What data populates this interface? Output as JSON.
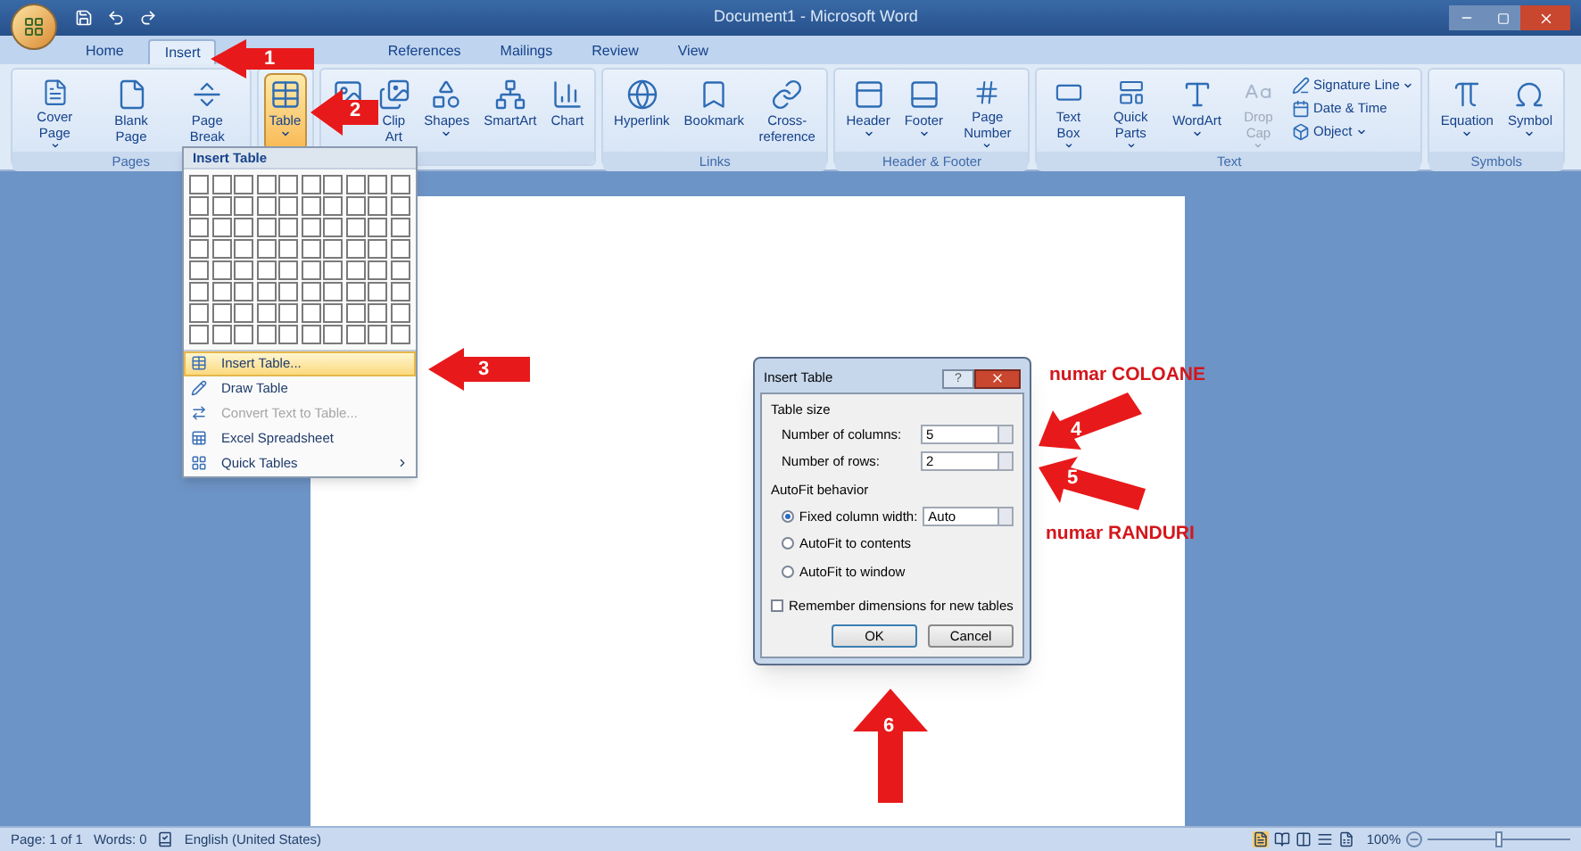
{
  "window": {
    "title": "Document1 - Microsoft Word"
  },
  "tabs": [
    {
      "label": "Home",
      "selected": false
    },
    {
      "label": "Insert",
      "selected": true
    },
    {
      "label": "References",
      "selected": false
    },
    {
      "label": "Mailings",
      "selected": false
    },
    {
      "label": "Review",
      "selected": false
    },
    {
      "label": "View",
      "selected": false
    }
  ],
  "ribbon_groups": [
    {
      "label": "Pages",
      "buttons": [
        {
          "kind": "large",
          "label": "Cover Page",
          "dropdown": true,
          "selected": false,
          "disabled": false
        },
        {
          "kind": "large",
          "label": "Blank Page",
          "dropdown": false,
          "selected": false,
          "disabled": false
        },
        {
          "kind": "large",
          "label": "Page Break",
          "dropdown": false,
          "selected": false,
          "disabled": false
        }
      ]
    },
    {
      "buttons": [
        {
          "kind": "large",
          "label": "Table",
          "dropdown": true,
          "selected": true,
          "disabled": false
        }
      ]
    },
    {
      "buttons": [
        {
          "kind": "large",
          "dropdown": false,
          "selected": false,
          "disabled": false
        },
        {
          "kind": "large",
          "label": "Clip Art",
          "dropdown": false,
          "selected": false,
          "disabled": false
        },
        {
          "kind": "large",
          "label": "Shapes",
          "dropdown": true,
          "selected": false,
          "disabled": false
        },
        {
          "kind": "large",
          "label": "SmartArt",
          "dropdown": false,
          "selected": false,
          "disabled": false
        },
        {
          "kind": "large",
          "label": "Chart",
          "dropdown": false,
          "selected": false,
          "disabled": false
        }
      ]
    },
    {
      "label": "Links",
      "buttons": [
        {
          "kind": "large",
          "label": "Hyperlink",
          "dropdown": false,
          "selected": false,
          "disabled": false
        },
        {
          "kind": "large",
          "label": "Bookmark",
          "dropdown": false,
          "selected": false,
          "disabled": false
        },
        {
          "kind": "large",
          "label": "Cross-reference",
          "dropdown": false,
          "selected": false,
          "disabled": false
        }
      ]
    },
    {
      "label": "Header & Footer",
      "buttons": [
        {
          "kind": "large",
          "label": "Header",
          "dropdown": true,
          "selected": false,
          "disabled": false
        },
        {
          "kind": "large",
          "label": "Footer",
          "dropdown": true,
          "selected": false,
          "disabled": false
        },
        {
          "kind": "large",
          "label": "Page Number",
          "dropdown": true,
          "selected": false,
          "disabled": false
        }
      ]
    },
    {
      "label": "Text",
      "buttons": [
        {
          "kind": "large",
          "label": "Text Box",
          "dropdown": true,
          "selected": false,
          "disabled": false
        },
        {
          "kind": "large",
          "label": "Quick Parts",
          "dropdown": true,
          "selected": false,
          "disabled": false
        },
        {
          "kind": "large",
          "label": "WordArt",
          "dropdown": true,
          "selected": false,
          "disabled": false
        },
        {
          "kind": "large",
          "label": "Drop Cap",
          "dropdown": true,
          "selected": false,
          "disabled": true
        },
        {
          "kind": "small",
          "label": "Signature Line",
          "dropdown": true,
          "selected": false,
          "disabled": false
        },
        {
          "kind": "small",
          "label": "Date & Time",
          "dropdown": false,
          "selected": false,
          "disabled": false
        },
        {
          "kind": "small",
          "label": "Object",
          "dropdown": true,
          "selected": false,
          "disabled": false
        }
      ]
    },
    {
      "label": "Symbols",
      "buttons": [
        {
          "kind": "large",
          "label": "Equation",
          "dropdown": true,
          "selected": false,
          "disabled": false
        },
        {
          "kind": "large",
          "label": "Symbol",
          "dropdown": true,
          "selected": false,
          "disabled": false
        }
      ]
    }
  ],
  "table_menu": {
    "title": "Insert Table",
    "items": [
      {
        "label": "Insert Table...",
        "selected": true,
        "disabled": false,
        "submenu": false
      },
      {
        "label": "Draw Table",
        "selected": false,
        "disabled": false,
        "submenu": false
      },
      {
        "label": "Convert Text to Table...",
        "selected": false,
        "disabled": true,
        "submenu": false
      },
      {
        "label": "Excel Spreadsheet",
        "selected": false,
        "disabled": false,
        "submenu": false
      },
      {
        "label": "Quick Tables",
        "selected": false,
        "disabled": false,
        "submenu": true
      }
    ]
  },
  "dialog": {
    "title": "Insert Table",
    "help": "?",
    "table_size": {
      "heading": "Table size",
      "fields": [
        {
          "label": "Number of columns:",
          "value": "5"
        },
        {
          "label": "Number of rows:",
          "value": "2"
        }
      ]
    },
    "autofit": {
      "heading": "AutoFit behavior",
      "options": [
        {
          "label": "Fixed column width:",
          "selected": true,
          "value": "Auto"
        },
        {
          "label": "AutoFit to contents",
          "selected": false
        },
        {
          "label": "AutoFit to window",
          "selected": false
        }
      ]
    },
    "remember": {
      "label": "Remember dimensions for new tables",
      "checked": false
    },
    "buttons": [
      "OK",
      "Cancel"
    ]
  },
  "annotations": {
    "arrows": [
      {
        "number": "1"
      },
      {
        "number": "2"
      },
      {
        "number": "3"
      },
      {
        "number": "4"
      },
      {
        "number": "5"
      },
      {
        "number": "6"
      }
    ],
    "labels": [
      "numar COLOANE",
      "numar RANDURI"
    ]
  },
  "status_bar": {
    "page": "Page: 1 of 1",
    "words": "Words: 0",
    "language": "English (United States)",
    "zoom": "100%",
    "zoom_slider": {
      "level": 0.5
    }
  }
}
